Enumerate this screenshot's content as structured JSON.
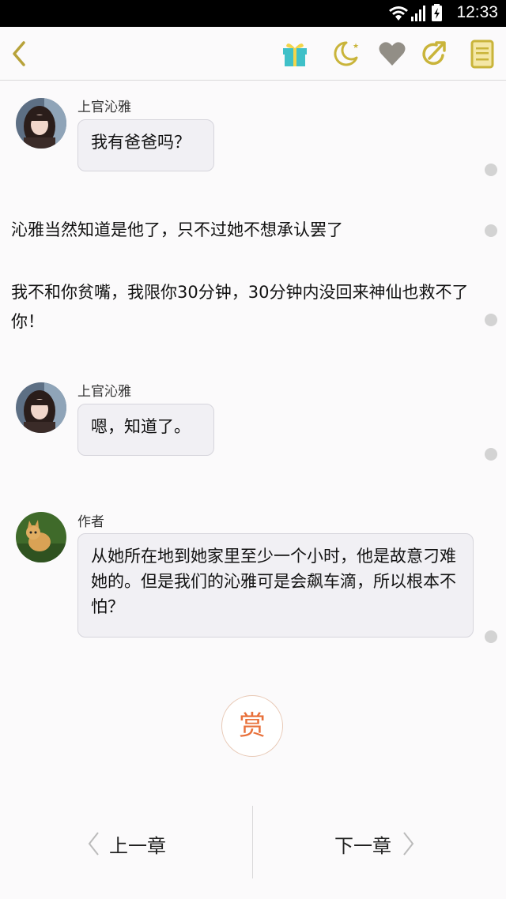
{
  "status": {
    "time": "12:33"
  },
  "toolbar": {
    "back_icon": "chevron-left-icon",
    "icons": [
      "gift-icon",
      "moon-icon",
      "heart-icon",
      "share-icon",
      "bookmark-icon"
    ]
  },
  "messages": [
    {
      "name": "上官沁雅",
      "text": "我有爸爸吗？"
    },
    {
      "name": "上官沁雅",
      "text": "嗯，知道了。"
    },
    {
      "name": "作者",
      "text": "从她所在地到她家里至少一个小时，他是故意刁难她的。但是我们的沁雅可是会飙车滴，所以根本不怕？"
    }
  ],
  "narrations": [
    "沁雅当然知道是他了，只不过她不想承认罢了",
    " 我不和你贫嘴，我限你30分钟，30分钟内没回来神仙也救不了你！"
  ],
  "reward": {
    "label": "赏"
  },
  "nav": {
    "prev": "上一章",
    "next": "下一章"
  },
  "colors": {
    "accent": "#e8703a",
    "icon_yellow": "#c9b43a",
    "bubble_bg": "#f1f0f4"
  }
}
